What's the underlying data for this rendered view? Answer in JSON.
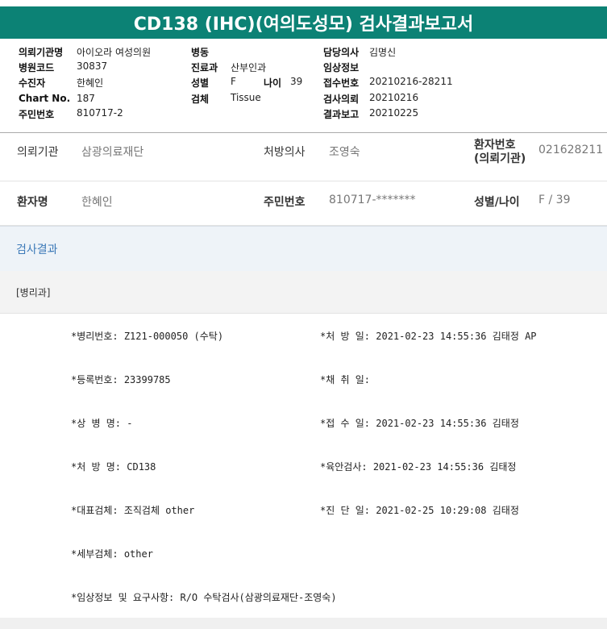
{
  "title": "CD138 (IHC)(여의도성모) 검사결과보고서",
  "header": {
    "col1": [
      {
        "label": "의뢰기관명",
        "value": "아이오라 여성의원"
      },
      {
        "label": "병원코드",
        "value": "30837"
      },
      {
        "label": "수진자",
        "value": "한혜인"
      },
      {
        "label": "Chart No.",
        "value": "187"
      },
      {
        "label": "주민번호",
        "value": "810717-2"
      }
    ],
    "col2": [
      {
        "label": "병동",
        "value": ""
      },
      {
        "label": "진료과",
        "value": "산부인과"
      },
      {
        "label": "성별",
        "value": "F"
      },
      {
        "label": "검체",
        "value": "Tissue"
      }
    ],
    "age": {
      "label": "나이",
      "value": "39"
    },
    "col3": [
      {
        "label": "담당의사",
        "value": "김명신"
      },
      {
        "label": "임상정보",
        "value": ""
      },
      {
        "label": "접수번호",
        "value": "20210216-28211"
      },
      {
        "label": "검사의뢰",
        "value": "20210216"
      },
      {
        "label": "결과보고",
        "value": "20210225"
      }
    ]
  },
  "info": {
    "row1": {
      "org_label": "의뢰기관",
      "org_value": "삼광의료재단",
      "doctor_label": "처방의사",
      "doctor_value": "조영숙",
      "pid_label_1": "환자번호",
      "pid_label_2": "(의뢰기관)",
      "pid_value": "021628211"
    },
    "row2": {
      "name_label": "환자명",
      "name_value": "한혜인",
      "ssn_label": "주민번호",
      "ssn_value": "810717-*******",
      "sexage_label": "성별/나이",
      "sexage_value": "F / 39"
    }
  },
  "section_title": "검사결과",
  "subsection": "[병리과]",
  "results": [
    {
      "left": "*병리번호: Z121-000050 (수탁)",
      "right": "*처 방 일: 2021-02-23 14:55:36  김태정 AP"
    },
    {
      "left": "*등록번호: 23399785",
      "right": "*채 취 일:"
    },
    {
      "left": "*상 병 명: -",
      "right": "*접 수 일: 2021-02-23 14:55:36  김태정"
    },
    {
      "left": "*처 방 명: CD138",
      "right": "*육안검사: 2021-02-23 14:55:36  김태정"
    },
    {
      "left": "*대표검체: 조직검체 other",
      "right": "*진 단 일: 2021-02-25 10:29:08  김태정"
    },
    {
      "left": "*세부검체: other",
      "right": ""
    },
    {
      "left": "*임상정보 및 요구사항: R/O 수탁검사(삼광의료재단-조영숙)",
      "right": ""
    }
  ]
}
